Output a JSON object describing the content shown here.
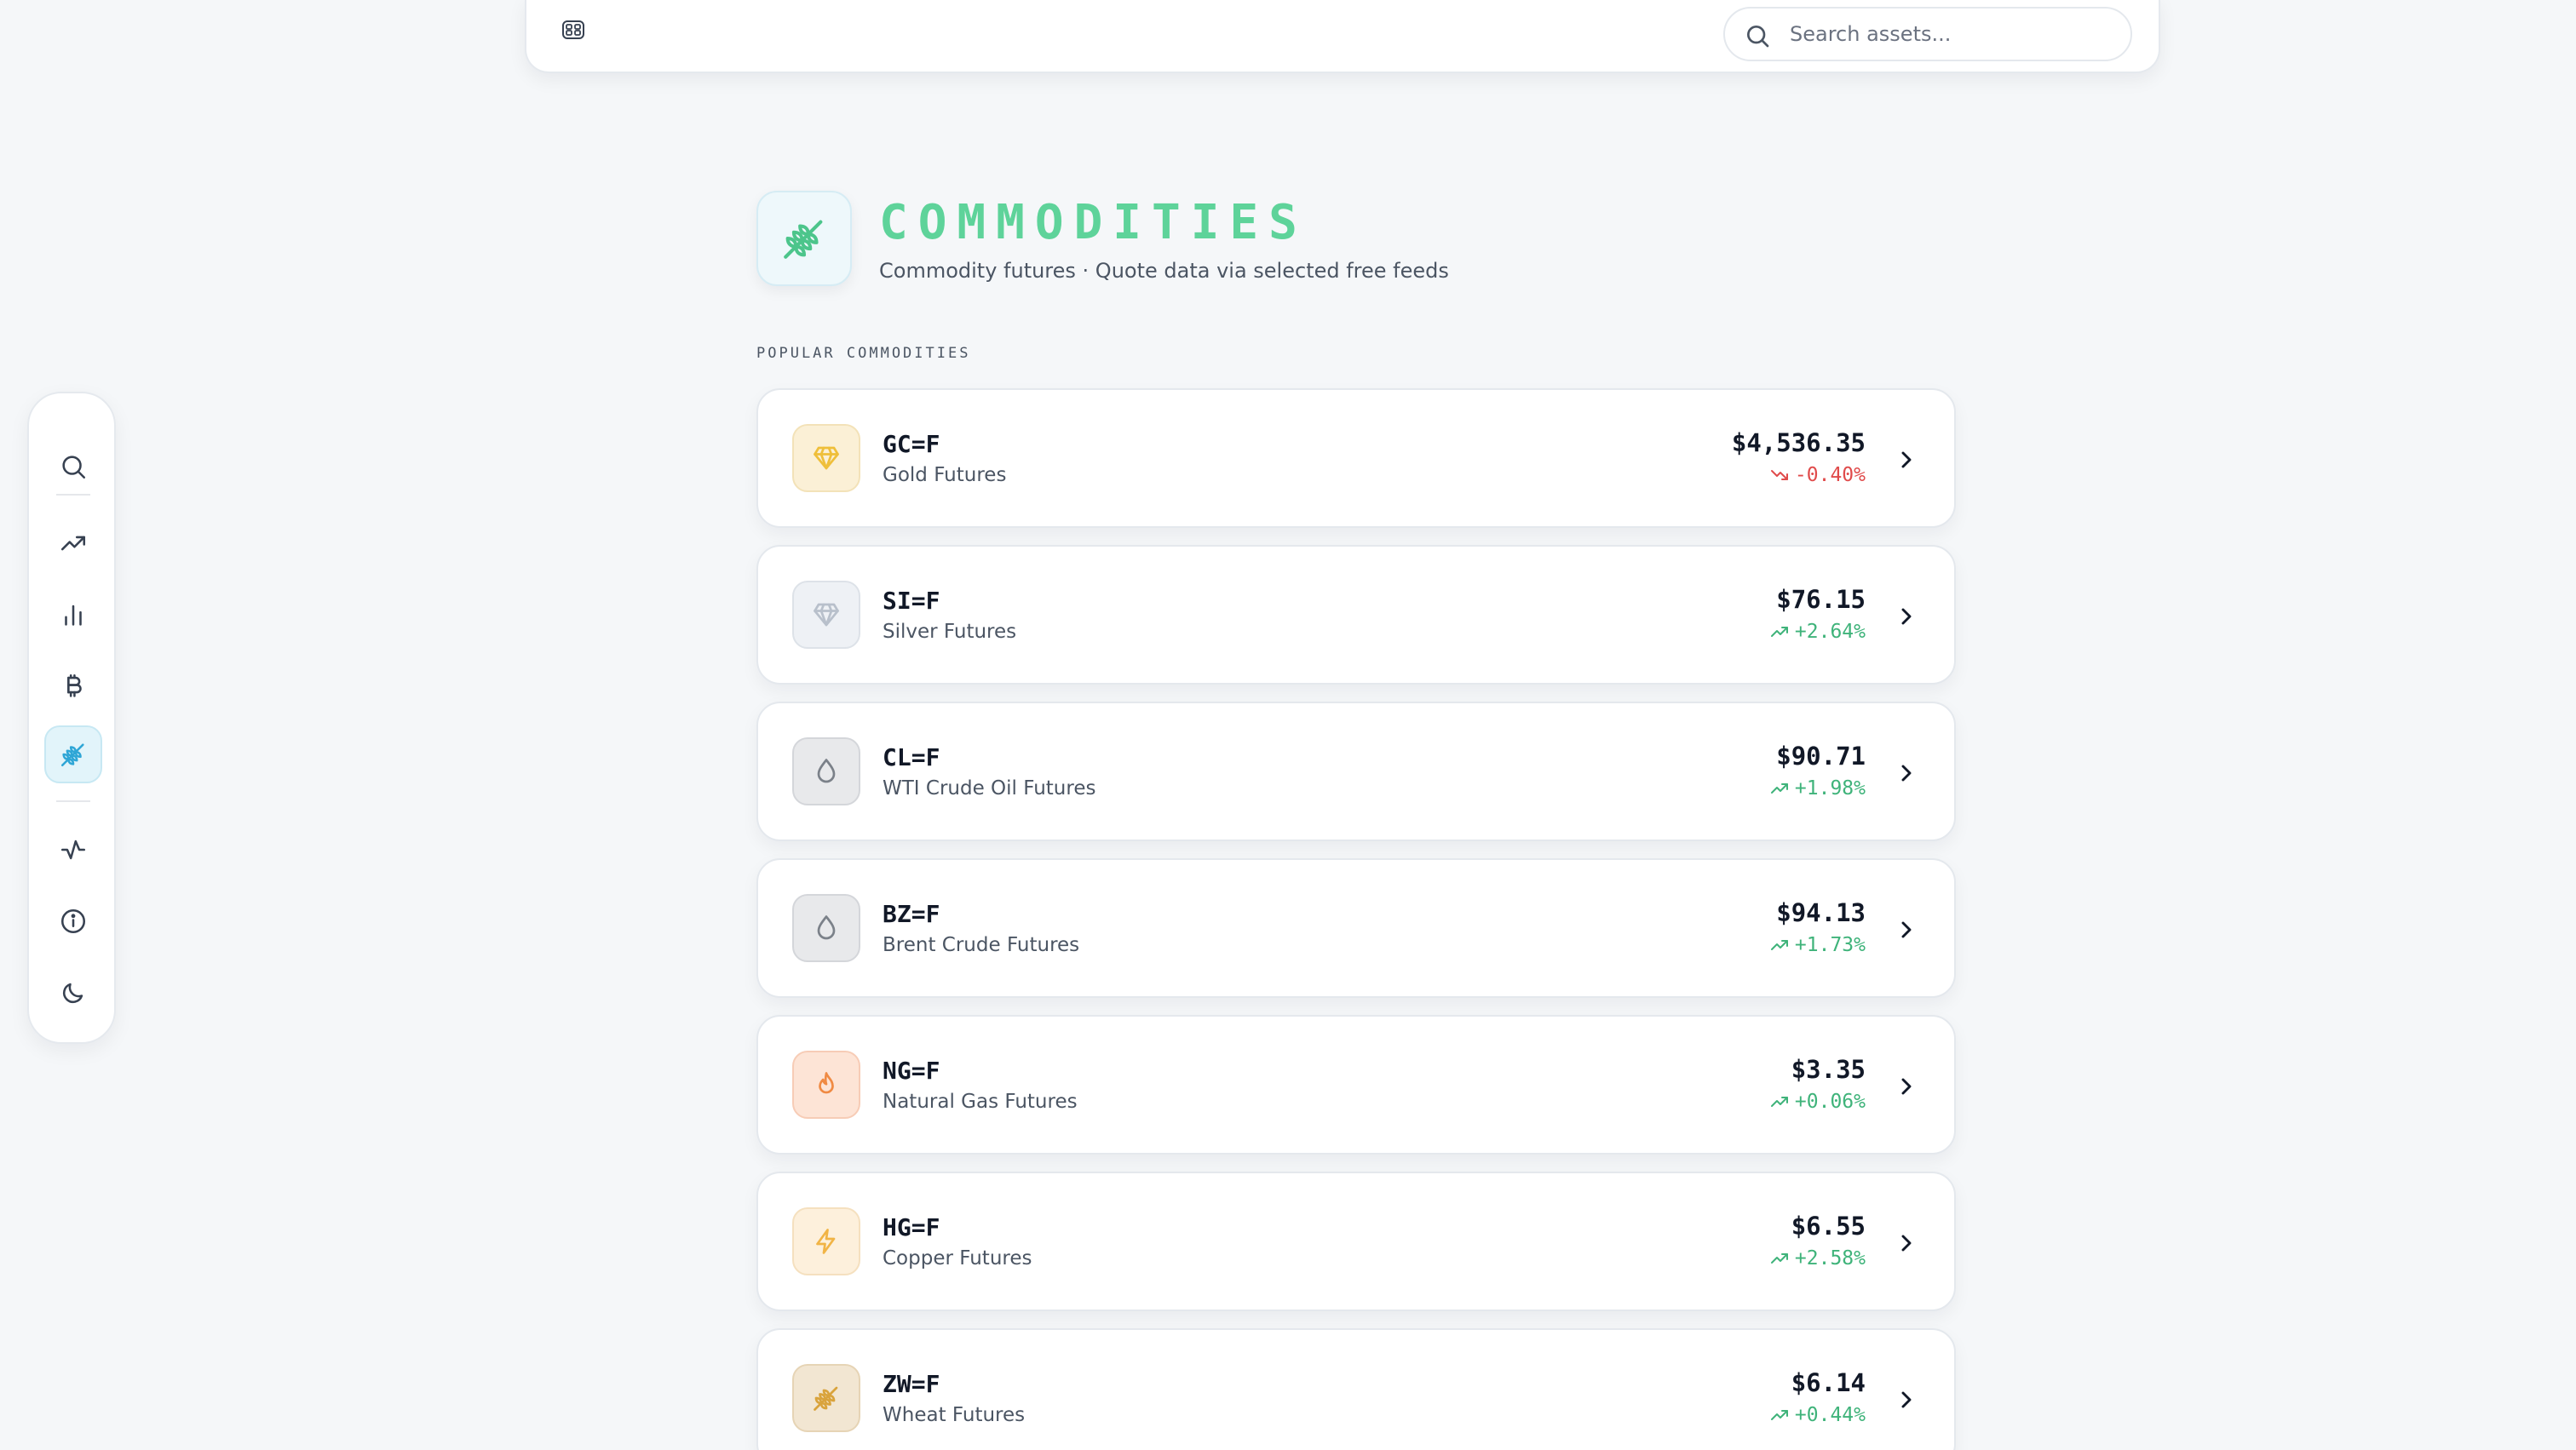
{
  "search": {
    "placeholder": "Search assets..."
  },
  "nav": {
    "items": [
      {
        "icon": "search-icon",
        "active": false
      },
      {
        "icon": "trending-up-icon",
        "active": false
      },
      {
        "icon": "bar-chart-icon",
        "active": false
      },
      {
        "icon": "bitcoin-icon",
        "active": false
      },
      {
        "icon": "wheat-icon",
        "active": true
      },
      {
        "icon": "activity-icon",
        "active": false
      },
      {
        "icon": "info-icon",
        "active": false
      },
      {
        "icon": "moon-icon",
        "active": false
      }
    ]
  },
  "header": {
    "title": "COMMODITIES",
    "subtitle": "Commodity futures · Quote data via selected free feeds"
  },
  "section": {
    "label": "POPULAR COMMODITIES"
  },
  "colors": {
    "accent": "#5ed39a",
    "up": "#3fb37a",
    "down": "#e04b4b",
    "active_nav_bg": "#e2f4fa"
  },
  "commodities": [
    {
      "symbol": "GC=F",
      "name": "Gold Futures",
      "price": "$4,536.35",
      "change": "-0.40%",
      "direction": "down",
      "icon": "gem-icon"
    },
    {
      "symbol": "SI=F",
      "name": "Silver Futures",
      "price": "$76.15",
      "change": "+2.64%",
      "direction": "up",
      "icon": "gem-icon"
    },
    {
      "symbol": "CL=F",
      "name": "WTI Crude Oil Futures",
      "price": "$90.71",
      "change": "+1.98%",
      "direction": "up",
      "icon": "droplet-icon"
    },
    {
      "symbol": "BZ=F",
      "name": "Brent Crude Futures",
      "price": "$94.13",
      "change": "+1.73%",
      "direction": "up",
      "icon": "droplet-icon"
    },
    {
      "symbol": "NG=F",
      "name": "Natural Gas Futures",
      "price": "$3.35",
      "change": "+0.06%",
      "direction": "up",
      "icon": "flame-icon"
    },
    {
      "symbol": "HG=F",
      "name": "Copper Futures",
      "price": "$6.55",
      "change": "+2.58%",
      "direction": "up",
      "icon": "zap-icon"
    },
    {
      "symbol": "ZW=F",
      "name": "Wheat Futures",
      "price": "$6.14",
      "change": "+0.44%",
      "direction": "up",
      "icon": "wheat-icon"
    }
  ]
}
